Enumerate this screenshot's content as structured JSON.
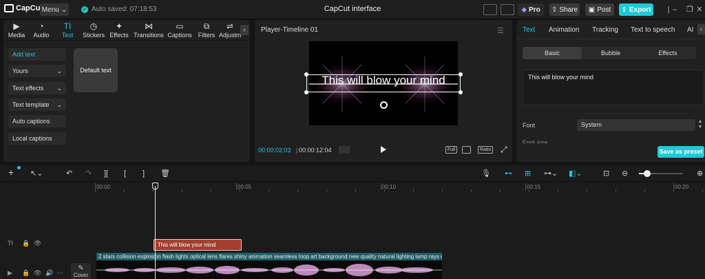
{
  "topbar": {
    "logo": "CapCut",
    "menu_label": "Menu",
    "autosave": "Auto saved: 07:18:53",
    "title": "CapCut interface",
    "pro_label": "Pro",
    "share_label": "Share",
    "post_label": "Post",
    "export_label": "Export"
  },
  "tool_tabs": [
    {
      "label": "Media"
    },
    {
      "label": "Audio"
    },
    {
      "label": "Text"
    },
    {
      "label": "Stickers"
    },
    {
      "label": "Effects"
    },
    {
      "label": "Transitions"
    },
    {
      "label": "Captions"
    },
    {
      "label": "Filters"
    },
    {
      "label": "Adjustm"
    }
  ],
  "text_categories": [
    {
      "label": "Add text"
    },
    {
      "label": "Yours"
    },
    {
      "label": "Text effects"
    },
    {
      "label": "Text template"
    },
    {
      "label": "Auto captions"
    },
    {
      "label": "Local captions"
    }
  ],
  "default_text_card": "Default text",
  "player": {
    "title": "Player-Timeline 01",
    "overlay_text": "This will blow your mind",
    "time_current": "00:00:02:03",
    "time_separator": "|",
    "time_total": "00:00:12:04",
    "full_label": "Full",
    "ratio_label": "Ratio"
  },
  "right_panel": {
    "tabs": [
      {
        "label": "Text"
      },
      {
        "label": "Animation"
      },
      {
        "label": "Tracking"
      },
      {
        "label": "Text to speech"
      },
      {
        "label": "AI"
      }
    ],
    "subtabs": [
      {
        "label": "Basic"
      },
      {
        "label": "Bubble"
      },
      {
        "label": "Effects"
      }
    ],
    "text_value": "This will blow your mind",
    "font_label": "Font",
    "font_value": "System",
    "font_size_label": "Font size",
    "save_preset": "Save as preset"
  },
  "timeline": {
    "ruler": [
      {
        "label": "00:00"
      },
      {
        "label": "00:05"
      },
      {
        "label": "00:10"
      },
      {
        "label": "00:15"
      },
      {
        "label": "00:20"
      }
    ],
    "text_clip": "This will blow your mind",
    "video_clip": "2 stars collision explosion flash lights optical lens flares shiny animation seamless loop art background new quality natural lighting lamp rays ef",
    "cover_label": "Cover"
  },
  "colors": {
    "accent": "#22c5d6",
    "text_clip": "#a23f30",
    "video_label_bg": "#1e5f6a"
  }
}
